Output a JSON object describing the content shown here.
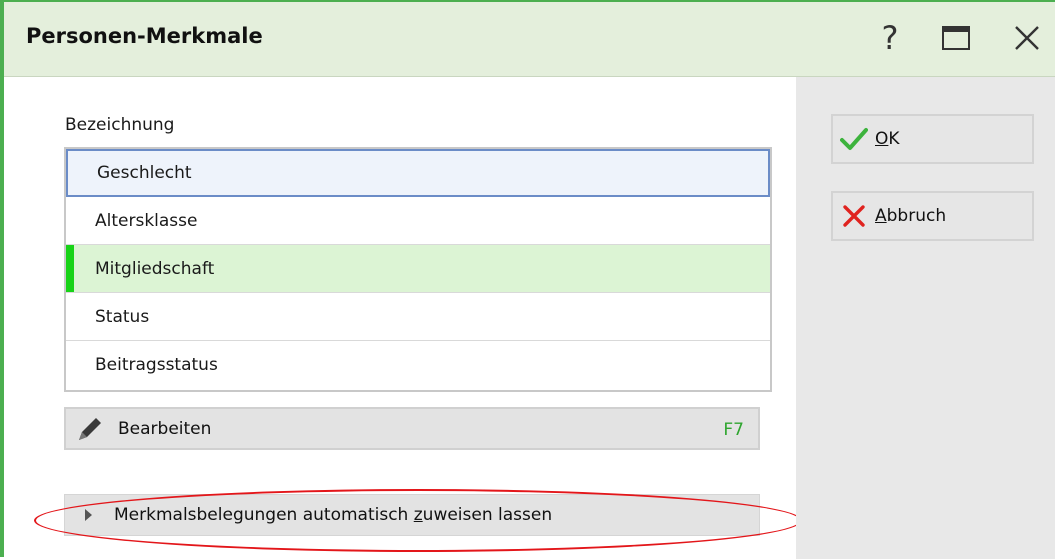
{
  "window": {
    "title": "Personen-Merkmale",
    "help_symbol": "?"
  },
  "field": {
    "label": "Bezeichnung"
  },
  "list": {
    "items": [
      {
        "label": "Geschlecht",
        "state": "selected"
      },
      {
        "label": "Altersklasse",
        "state": "normal"
      },
      {
        "label": "Mitgliedschaft",
        "state": "marked"
      },
      {
        "label": "Status",
        "state": "normal"
      },
      {
        "label": "Beitragsstatus",
        "state": "normal"
      }
    ]
  },
  "edit": {
    "label": "Bearbeiten",
    "shortcut": "F7",
    "icon": "pencil-icon"
  },
  "expander": {
    "label_pre": "Merkmalsbelegungen automatisch ",
    "label_accel": "z",
    "label_post": "uweisen lassen"
  },
  "buttons": {
    "ok_accel": "O",
    "ok_rest": "K",
    "cancel_accel": "A",
    "cancel_rest": "bbruch"
  },
  "colors": {
    "titlebar": "#e4efdc",
    "accent_green": "#4caf50",
    "marker_green": "#17d317",
    "highlight_ellipse": "#e3161a",
    "selection_border": "#6b8cc7"
  }
}
